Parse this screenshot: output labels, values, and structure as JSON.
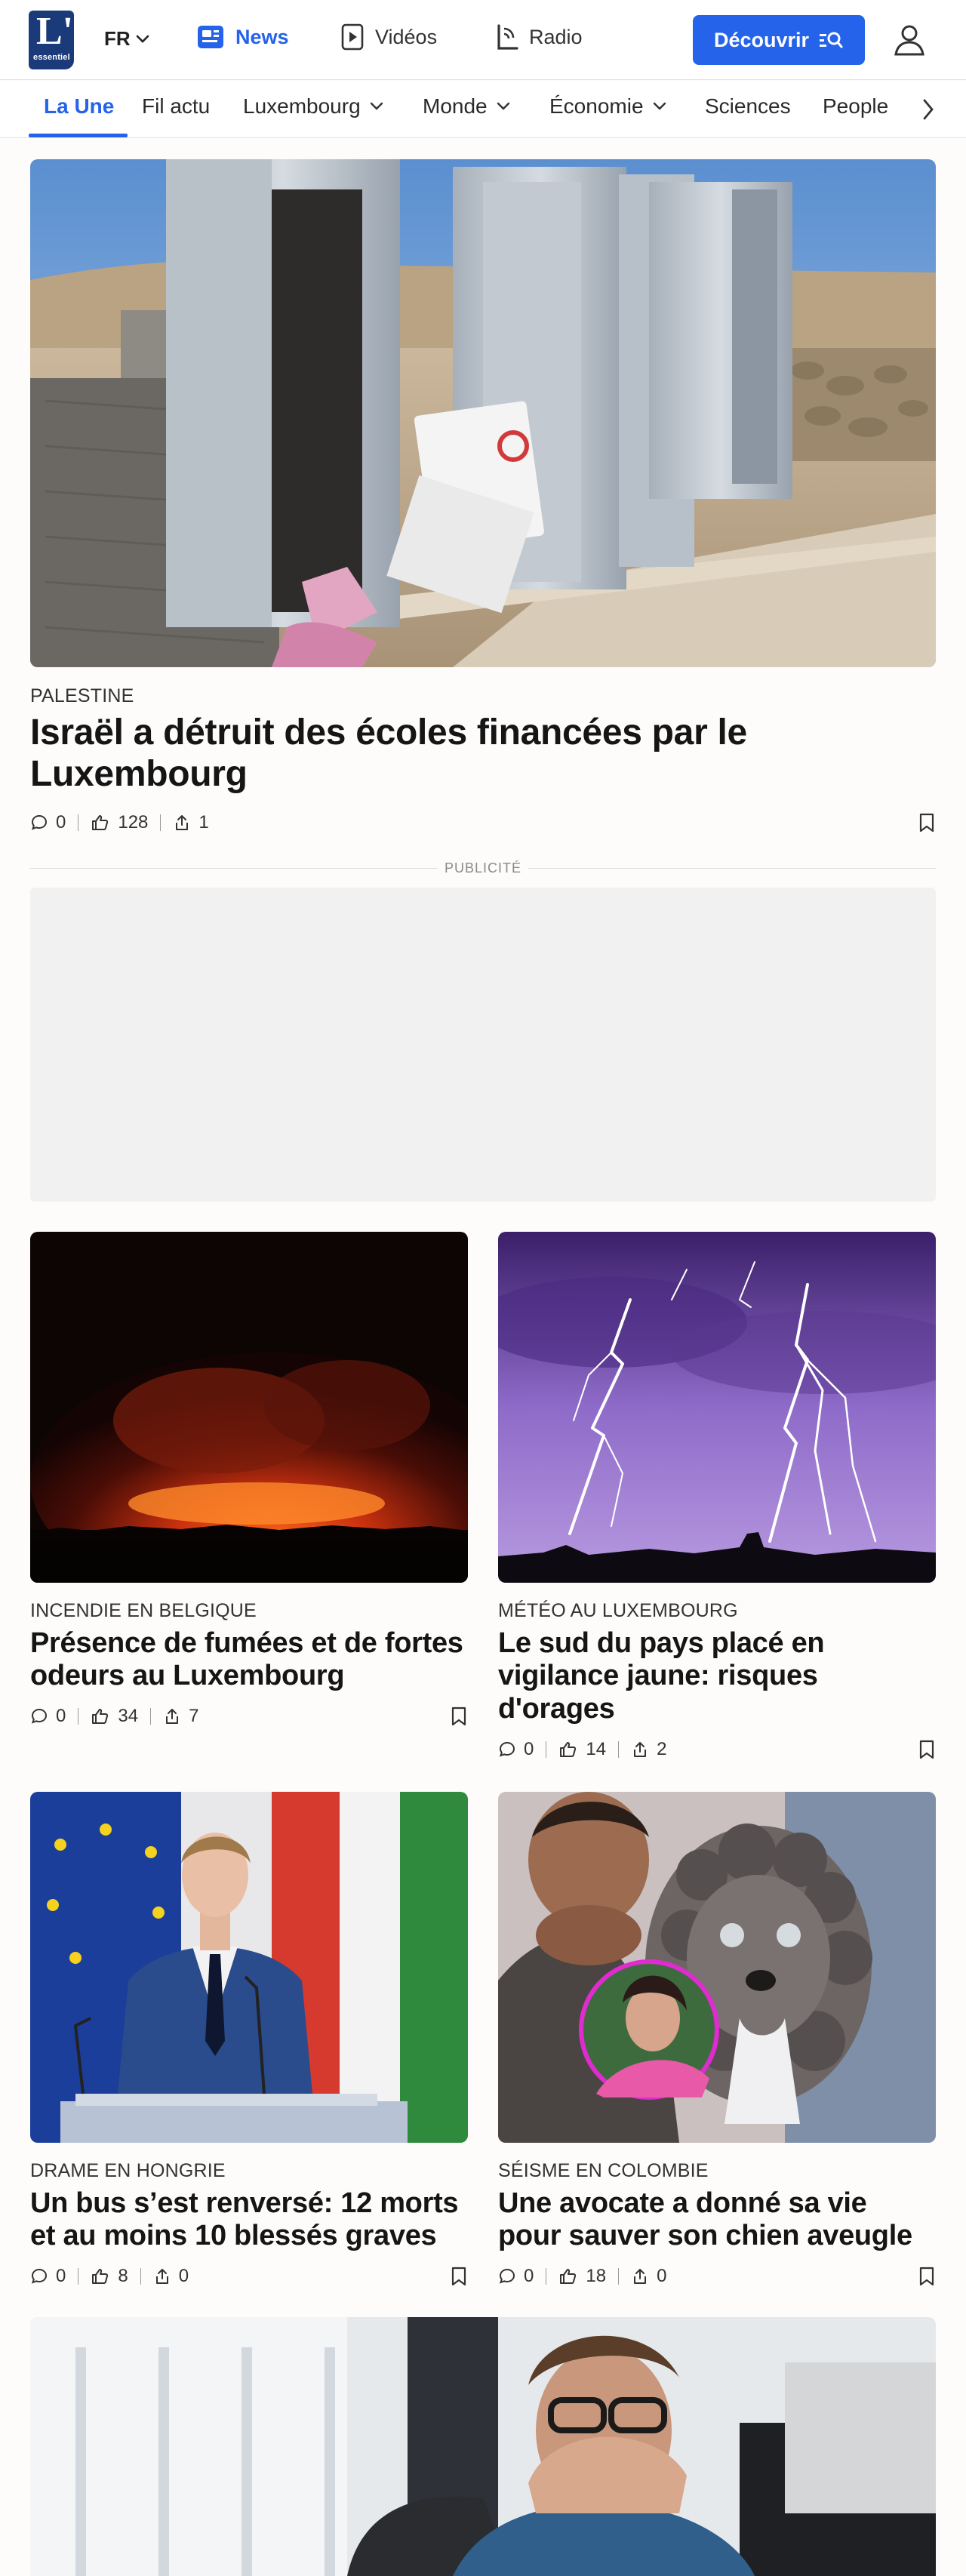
{
  "header": {
    "logo_text": "L'",
    "logo_small": "essentiel",
    "language": "FR",
    "nav": [
      {
        "label": "News",
        "icon": "newspaper-icon",
        "active": true
      },
      {
        "label": "Vidéos",
        "icon": "play-icon",
        "active": false
      },
      {
        "label": "Radio",
        "icon": "radio-icon",
        "active": false
      }
    ],
    "discover_label": "Découvrir",
    "accent": "#2563eb"
  },
  "subnav": {
    "items": [
      "La Une",
      "Fil actu",
      "Luxembourg",
      "Monde",
      "Économie",
      "Sciences",
      "People"
    ],
    "active": "La Une"
  },
  "hero": {
    "kicker": "PALESTINE",
    "title": "Israël a détruit des écoles financées par le Luxembourg",
    "comments": "0",
    "likes": "128",
    "shares": "1"
  },
  "ad": {
    "label": "PUBLICITÉ"
  },
  "cards": [
    {
      "kicker": "INCENDIE EN BELGIQUE",
      "title": "Présence de fumées et de fortes odeurs au Luxembourg",
      "comments": "0",
      "likes": "34",
      "shares": "7"
    },
    {
      "kicker": "MÉTÉO AU LUXEMBOURG",
      "title": "Le sud du pays placé en vigilance jaune: risques d'orages",
      "comments": "0",
      "likes": "14",
      "shares": "2"
    },
    {
      "kicker": "DRAME EN HONGRIE",
      "title": "Un bus s’est renversé: 12 morts et au moins 10 blessés graves",
      "comments": "0",
      "likes": "8",
      "shares": "0"
    },
    {
      "kicker": "SÉISME EN COLOMBIE",
      "title": "Une avocate a donné sa vie pour sauver son chien aveugle",
      "comments": "0",
      "likes": "18",
      "shares": "0"
    }
  ]
}
